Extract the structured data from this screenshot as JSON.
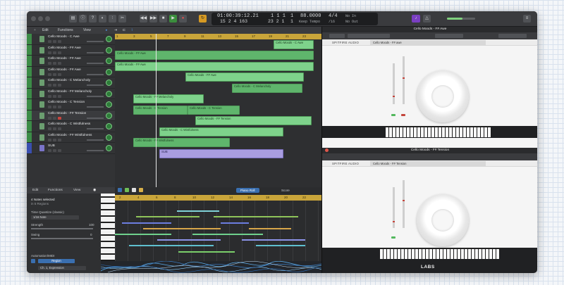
{
  "transport": {
    "time": "01:00:39:12.21",
    "bars": "15  2  4  163",
    "beats_top": "1   1   1",
    "beats_bottom": "23  2  1",
    "one_top": "1",
    "one_bottom": "1",
    "tempo": "88.0000",
    "tempo_mode": "Keep Tempo",
    "sig": "4/4",
    "division": "/16",
    "in": "No In",
    "out": "No Out"
  },
  "tracks_menu": {
    "edit": "Edit",
    "functions": "Functions",
    "view": "View"
  },
  "tracks": [
    {
      "name": "Cello Moods - C Awe"
    },
    {
      "name": "Cello Moods - F# Awe"
    },
    {
      "name": "Cello Moods - F# Awe"
    },
    {
      "name": "Cello Moods - F# Awe"
    },
    {
      "name": "Cello Moods - C Melancholy"
    },
    {
      "name": "Cello Moods - F# Melancholy"
    },
    {
      "name": "Cello Moods - C Tension"
    },
    {
      "name": "Cello Moods - F# Tension"
    },
    {
      "name": "Cello Moods - C Wistfulness"
    },
    {
      "name": "Cello Moods - F# Wistfulness"
    },
    {
      "name": "SUB"
    }
  ],
  "ruler_marks": [
    "1",
    "3",
    "5",
    "7",
    "9",
    "11",
    "13",
    "15",
    "17",
    "19",
    "21",
    "23"
  ],
  "regions": [
    {
      "label": "Cello Moods - C Awe"
    },
    {
      "label": "Cello Moods - F# Awe"
    },
    {
      "label": "Cello Moods - F# Awe"
    },
    {
      "label": "Cello Moods - F# Awe"
    },
    {
      "label": "Cello Moods - C Melancholy"
    },
    {
      "label": "Cello Moods - F# Melancholy"
    },
    {
      "label": "Cello Moods - C Tension"
    },
    {
      "label": "Cello Moods - C Tension"
    },
    {
      "label": "Cello Moods - F# Tension"
    },
    {
      "label": "Cello Moods - C Wistfulness"
    },
    {
      "label": "Cello Moods - F# Wistfulness"
    },
    {
      "label": "SUB"
    }
  ],
  "editor_tabs": {
    "piano_roll": "Piano Roll",
    "score": "Score",
    "step": "Step Sequencer"
  },
  "editor_menu": {
    "edit": "Edit",
    "functions": "Functions",
    "view": "View"
  },
  "inspector": {
    "notes_selected": "4 Notes selected",
    "regions": "in 5 Regions",
    "quantize_label": "Time Quantize (classic)",
    "quantize_value": "1/16 Note",
    "strength_label": "Strength",
    "strength_value": "100",
    "swing_label": "Swing",
    "swing_value": "0",
    "automation_label": "Automation/MIDI",
    "region_btn": "Region",
    "cc_value": "Ch. 1, Expression"
  },
  "pr_ruler": [
    "2",
    "4",
    "6",
    "8",
    "10",
    "12",
    "14",
    "16",
    "18",
    "20",
    "22"
  ],
  "plugin_top": {
    "title": "Cello Moods - F# Awe",
    "brand": "SPITFIRE AUDIO",
    "preset": "Cello Moods - F# awe"
  },
  "plugin_bottom": {
    "title": "Cello Moods - F# Tension",
    "brand": "SPITFIRE AUDIO",
    "preset": "Cello Moods - F# Tension",
    "footer": "LABS"
  }
}
